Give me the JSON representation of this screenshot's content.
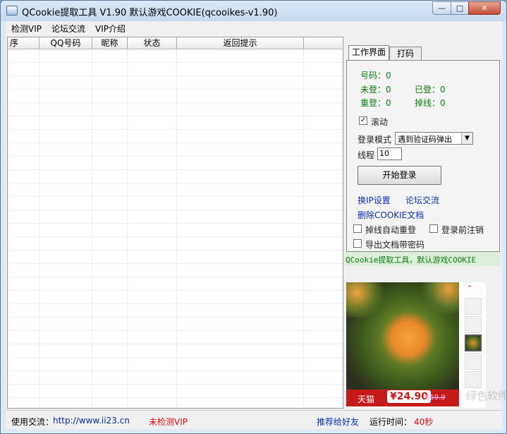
{
  "window": {
    "title": "QCookie提取工具 V1.90 默认游戏COOKIE(qcooikes-v1.90)"
  },
  "menu": [
    "检测VIP",
    "论坛交流",
    "VIP介绍"
  ],
  "grid": {
    "columns": [
      "序",
      "QQ号码",
      "昵称",
      "状态",
      "返回提示"
    ]
  },
  "tabs": [
    "工作界面",
    "打码"
  ],
  "stats": {
    "account_label": "号码：",
    "account_value": "0",
    "not_logged_label": "未登：",
    "not_logged_value": "0",
    "logged_label": "已登：",
    "logged_value": "0",
    "relogin_label": "重登：",
    "relogin_value": "0",
    "dropped_label": "掉线：",
    "dropped_value": "0"
  },
  "scroll": {
    "label": "滚动",
    "checked": true
  },
  "login_mode": {
    "label": "登录模式",
    "value": "遇到验证码弹出"
  },
  "threads": {
    "label": "线程",
    "value": "10"
  },
  "start_button": "开始登录",
  "links": {
    "ip_settings": "换IP设置",
    "forum": "论坛交流",
    "delete_cookie": "删除COOKIE文档"
  },
  "options": {
    "auto_relogin": {
      "label": "掉线自动重登",
      "checked": false
    },
    "logout_before": {
      "label": "登录前注销",
      "checked": false
    },
    "export_with_password": {
      "label": "导出文档带密码",
      "checked": false
    }
  },
  "banner_text": "QCookie提取工具，默认游戏COOKIE",
  "ad": {
    "brand": "天猫",
    "price": "¥24.90",
    "old_price": "¥59.9",
    "watermark": "绿色软件园"
  },
  "status": {
    "contact_label": "使用交流：",
    "contact_url": "http://www.ii23.cn",
    "vip_status": "未检测VIP",
    "recommend": "推荐给好友",
    "runtime_label": "运行时间：",
    "runtime_value": "40秒"
  },
  "colors": {
    "stat_green": "#0a7d0a",
    "link_blue": "#0b2fa8",
    "vip_red": "#d01010"
  }
}
